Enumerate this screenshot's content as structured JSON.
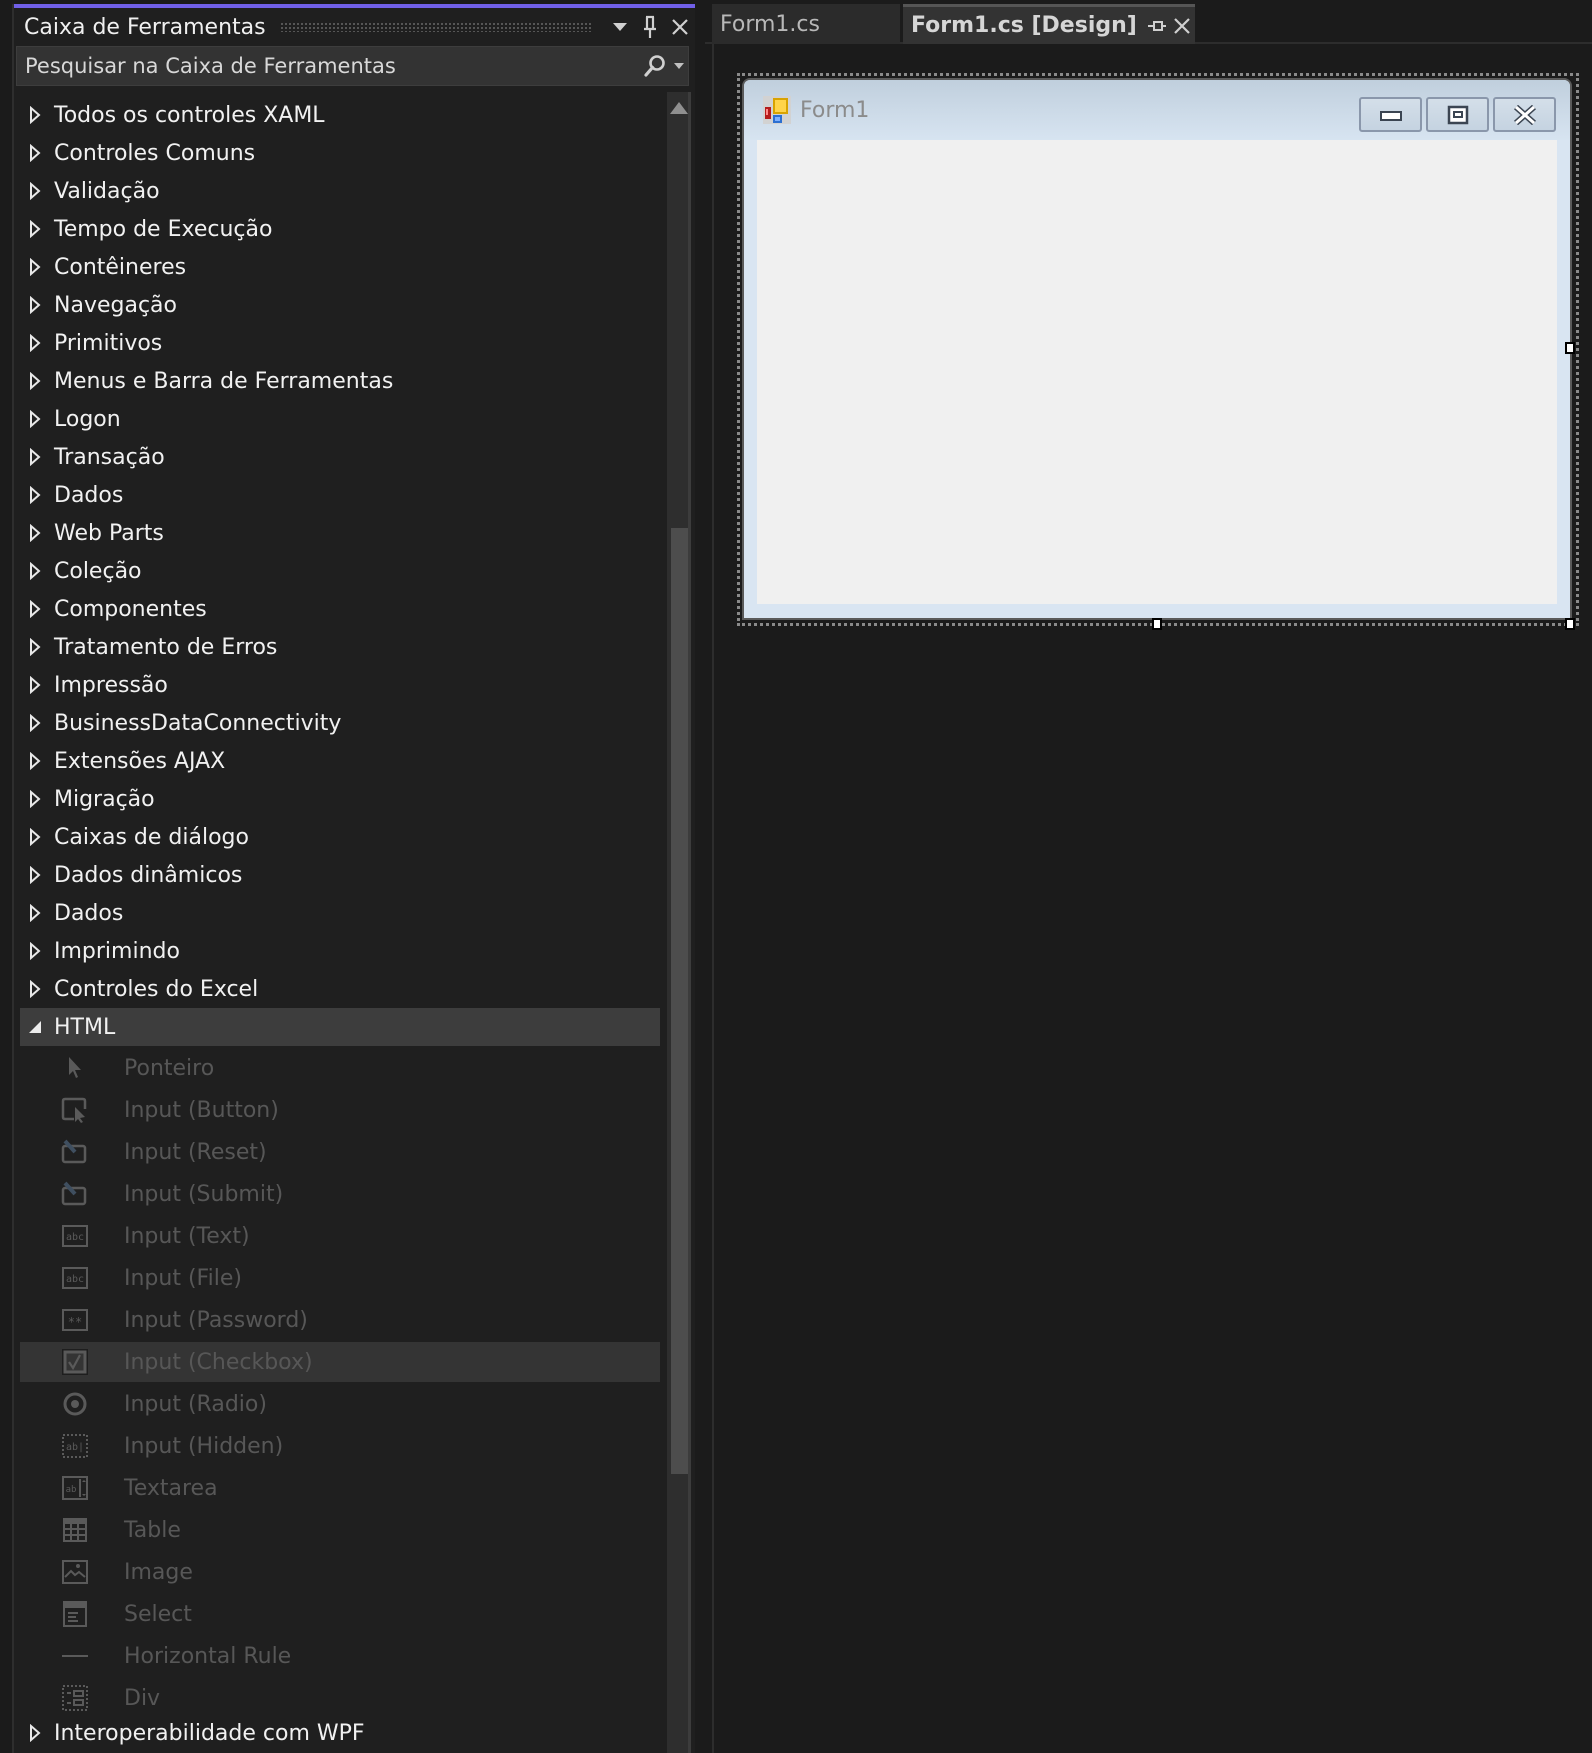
{
  "toolbox": {
    "title": "Caixa de Ferramentas",
    "accent_color": "#7160e8",
    "buttons": {
      "dropdown_icon": "chevron-down-icon",
      "pin_icon": "pin-icon",
      "close_icon": "close-icon"
    },
    "search": {
      "placeholder": "Pesquisar na Caixa de Ferramentas",
      "value": "",
      "icon": "search-icon"
    },
    "categories_before": [
      "Todos os controles XAML",
      "Controles Comuns",
      "Validação",
      "Tempo de Execução",
      "Contêineres",
      "Navegação",
      "Primitivos",
      "Menus e Barra de Ferramentas",
      "Logon",
      "Transação",
      "Dados",
      "Web Parts",
      "Coleção",
      "Componentes",
      "Tratamento de Erros",
      "Impressão",
      "BusinessDataConnectivity",
      "Extensões AJAX",
      "Migração",
      "Caixas de diálogo",
      "Dados dinâmicos",
      "Dados",
      "Imprimindo",
      "Controles do Excel"
    ],
    "expanded_category": {
      "label": "HTML",
      "items": [
        {
          "label": "Ponteiro",
          "icon": "pointer-icon"
        },
        {
          "label": "Input (Button)",
          "icon": "button-icon"
        },
        {
          "label": "Input (Reset)",
          "icon": "reset-icon"
        },
        {
          "label": "Input (Submit)",
          "icon": "submit-icon"
        },
        {
          "label": "Input (Text)",
          "icon": "textbox-icon"
        },
        {
          "label": "Input (File)",
          "icon": "file-input-icon"
        },
        {
          "label": "Input (Password)",
          "icon": "password-icon"
        },
        {
          "label": "Input (Checkbox)",
          "icon": "checkbox-icon",
          "hovered": true
        },
        {
          "label": "Input (Radio)",
          "icon": "radio-icon"
        },
        {
          "label": "Input (Hidden)",
          "icon": "hidden-input-icon"
        },
        {
          "label": "Textarea",
          "icon": "textarea-icon"
        },
        {
          "label": "Table",
          "icon": "table-icon"
        },
        {
          "label": "Image",
          "icon": "image-icon"
        },
        {
          "label": "Select",
          "icon": "select-icon"
        },
        {
          "label": "Horizontal Rule",
          "icon": "horizontal-rule-icon"
        },
        {
          "label": "Div",
          "icon": "div-icon"
        }
      ]
    },
    "categories_after": [
      "Interoperabilidade com WPF"
    ]
  },
  "editor": {
    "tabs": [
      {
        "label": "Form1.cs",
        "active": false
      },
      {
        "label": "Form1.cs [Design]",
        "active": true
      }
    ]
  },
  "designer": {
    "form_title": "Form1",
    "client_color": "#f0f0f0",
    "titlebar_buttons": [
      "minimize",
      "maximize",
      "close"
    ]
  }
}
